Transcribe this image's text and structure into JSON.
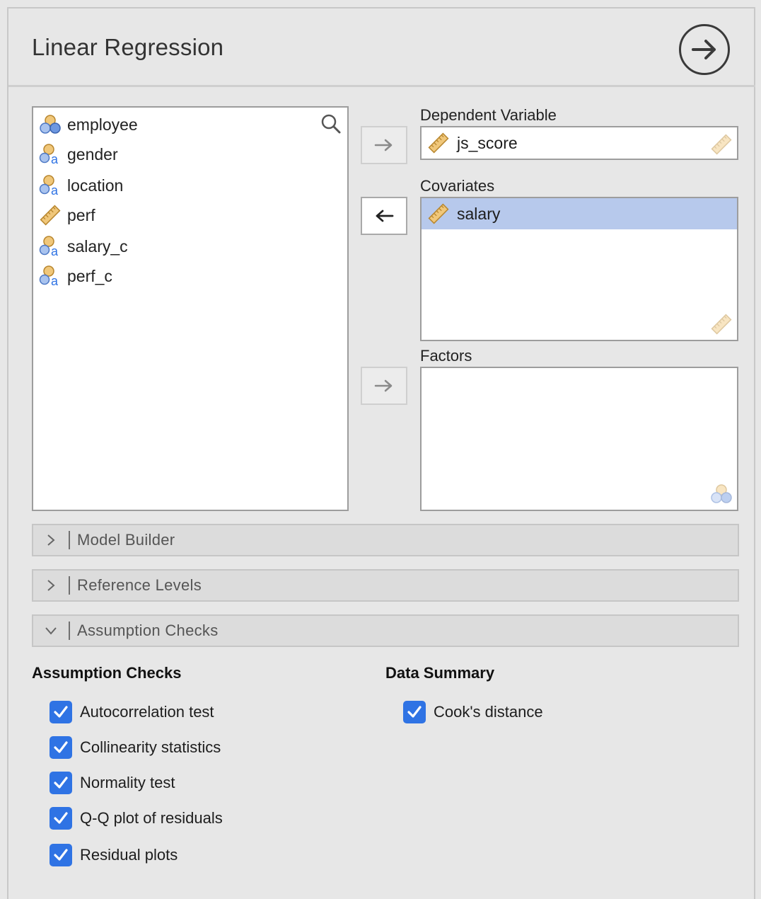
{
  "header": {
    "title": "Linear Regression"
  },
  "variables": [
    {
      "name": "employee",
      "type": "nominal"
    },
    {
      "name": "gender",
      "type": "nominal-text"
    },
    {
      "name": "location",
      "type": "nominal-text"
    },
    {
      "name": "perf",
      "type": "continuous"
    },
    {
      "name": "salary_c",
      "type": "nominal-text"
    },
    {
      "name": "perf_c",
      "type": "nominal-text"
    }
  ],
  "dependent": {
    "label": "Dependent Variable",
    "value": "js_score"
  },
  "covariates": {
    "label": "Covariates",
    "items": [
      "salary"
    ]
  },
  "factors": {
    "label": "Factors"
  },
  "sections": {
    "model_builder": "Model Builder",
    "reference_levels": "Reference Levels",
    "assumption_checks": "Assumption Checks"
  },
  "assumption_checks": {
    "heading": "Assumption Checks",
    "options": [
      {
        "label": "Autocorrelation test",
        "checked": true
      },
      {
        "label": "Collinearity statistics",
        "checked": true
      },
      {
        "label": "Normality test",
        "checked": true
      },
      {
        "label": "Q-Q plot of residuals",
        "checked": true
      },
      {
        "label": "Residual plots",
        "checked": true
      }
    ]
  },
  "data_summary": {
    "heading": "Data Summary",
    "options": [
      {
        "label": "Cook's distance",
        "checked": true
      }
    ]
  },
  "colors": {
    "accent": "#2f73e4",
    "selection": "#b7c9ec",
    "ruler": "#e8a73a"
  }
}
